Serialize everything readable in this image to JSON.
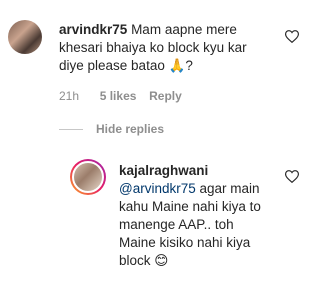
{
  "comments": [
    {
      "username": "arvindkr75",
      "text_line1": "Mam aapne mere",
      "text_line2": "khesari bhaiya ko block kyu kar",
      "text_line3": "diye please batao",
      "emoji": "🙏",
      "text_suffix": "?",
      "time": "21h",
      "likes": "5 likes",
      "reply_label": "Reply",
      "hide_replies_label": "Hide replies"
    }
  ],
  "reply": {
    "username": "kajalraghwani",
    "mention": "@arvindkr75",
    "text_line1_rest": " agar main",
    "text_line2": "kahu Maine nahi kiya to",
    "text_line3": "manenge AAP.. toh",
    "text_line4": "Maine kisiko nahi kiya",
    "text_line5": "block",
    "emoji": "😊"
  },
  "icons": {
    "like": "heart-outline-icon"
  }
}
